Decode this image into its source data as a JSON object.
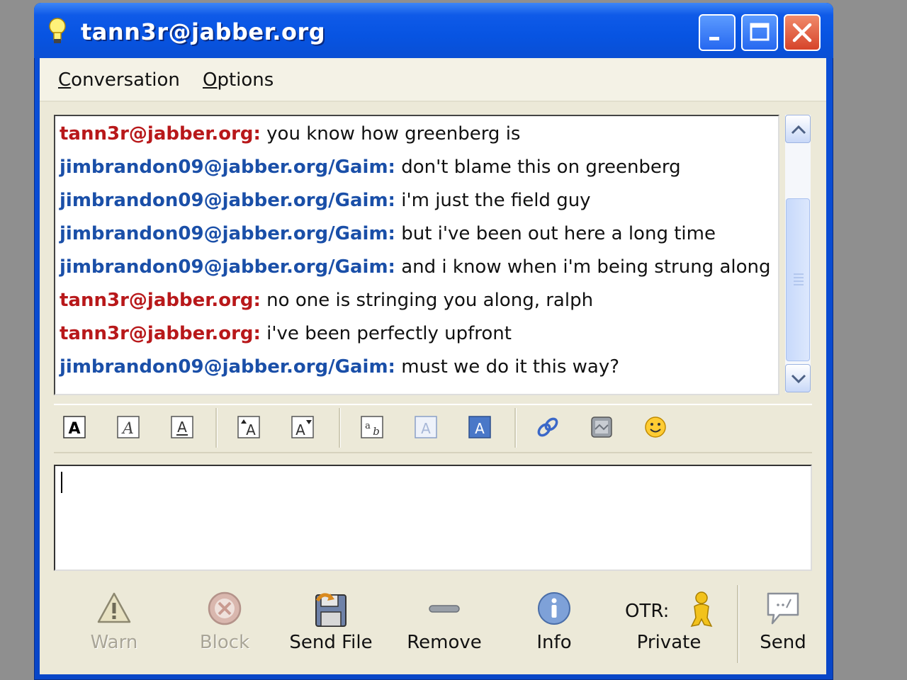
{
  "window": {
    "title": "tann3r@jabber.org"
  },
  "menu": {
    "conversation_first": "C",
    "conversation_rest": "onversation",
    "options_first": "O",
    "options_rest": "ptions"
  },
  "log": {
    "messages": [
      {
        "sender": "tann3r@jabber.org:",
        "text": " you know how greenberg is",
        "self": true
      },
      {
        "sender": "jimbrandon09@jabber.org/Gaim:",
        "text": " don't blame this on greenberg",
        "self": false
      },
      {
        "sender": "jimbrandon09@jabber.org/Gaim:",
        "text": " i'm just the field guy",
        "self": false
      },
      {
        "sender": "jimbrandon09@jabber.org/Gaim:",
        "text": " but i've been out here a long time",
        "self": false
      },
      {
        "sender": "jimbrandon09@jabber.org/Gaim:",
        "text": " and i know when i'm being strung along",
        "self": false
      },
      {
        "sender": "tann3r@jabber.org:",
        "text": " no one is stringing you along, ralph",
        "self": true
      },
      {
        "sender": "tann3r@jabber.org:",
        "text": " i've been perfectly upfront",
        "self": true
      },
      {
        "sender": "jimbrandon09@jabber.org/Gaim:",
        "text": " must we do it this way?",
        "self": false
      }
    ]
  },
  "buttons": {
    "warn": "Warn",
    "block": "Block",
    "send_file": "Send File",
    "remove": "Remove",
    "info": "Info",
    "otr_label": "OTR:",
    "otr_status": "Private",
    "send": "Send"
  },
  "colors": {
    "self_sender": "#b8181a",
    "other_sender": "#1a4fa8",
    "titlebar": "#0754e2"
  }
}
